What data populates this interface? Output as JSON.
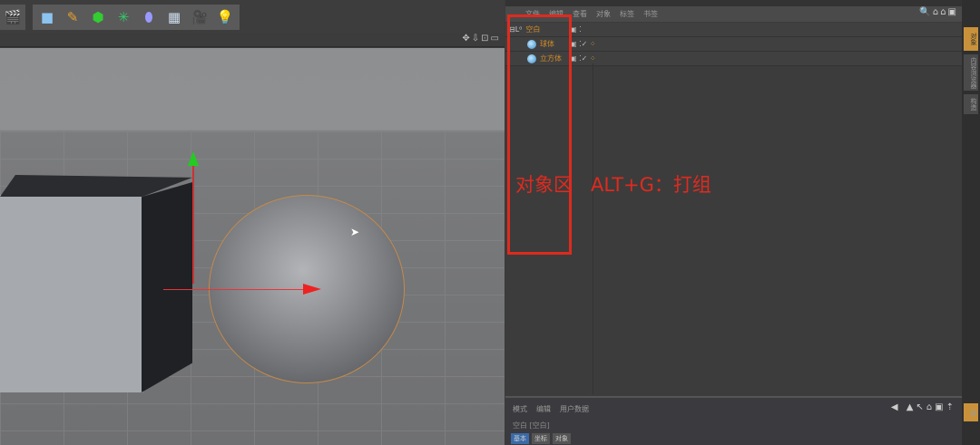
{
  "toolbar": {
    "icons": [
      "render-settings",
      "cube",
      "pen",
      "subdivision",
      "array",
      "deformer",
      "floor",
      "camera",
      "light"
    ]
  },
  "object_manager": {
    "menu": [
      "文件",
      "编辑",
      "查看",
      "对象",
      "标签",
      "书签"
    ],
    "objects": [
      {
        "name": "空白",
        "type": "null"
      },
      {
        "name": "球体",
        "type": "sphere"
      },
      {
        "name": "立方体",
        "type": "cube"
      }
    ]
  },
  "attributes": {
    "menu": [
      "模式",
      "编辑",
      "用户数据"
    ],
    "title": "空白 [空白]",
    "tabs": [
      "基本",
      "坐标",
      "对象"
    ]
  },
  "right_tabs": [
    "对象",
    "内容浏览器",
    "构造",
    "层"
  ],
  "annotation": "对象区   ALT+G：打组",
  "colors": {
    "highlight": "#e02a1e",
    "object_name": "#d18a2a"
  }
}
